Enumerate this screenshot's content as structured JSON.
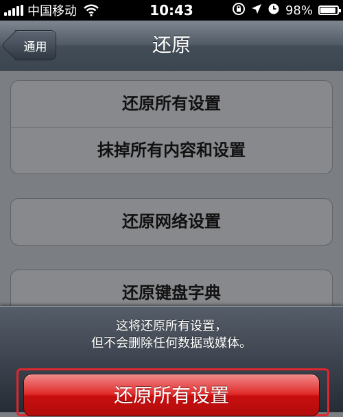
{
  "status_bar": {
    "carrier": "中国移动",
    "time": "10:43",
    "battery": "98%",
    "battery_level": 0.98,
    "icons": [
      "signal-icon",
      "wifi-icon",
      "rotation-lock-icon",
      "location-icon",
      "alarm-icon",
      "battery-icon"
    ]
  },
  "nav": {
    "back_label": "通用",
    "title": "还原"
  },
  "groups": [
    {
      "items": [
        "还原所有设置",
        "抹掉所有内容和设置"
      ]
    },
    {
      "items": [
        "还原网络设置"
      ]
    },
    {
      "items": [
        "还原键盘字典"
      ]
    }
  ],
  "action_sheet": {
    "message_line1": "这将还原所有设置，",
    "message_line2": "但不会删除任何数据或媒体。",
    "destructive_label": "还原所有设置"
  },
  "colors": {
    "destructive": "#d61a1a",
    "highlight_frame": "#e0262c"
  }
}
